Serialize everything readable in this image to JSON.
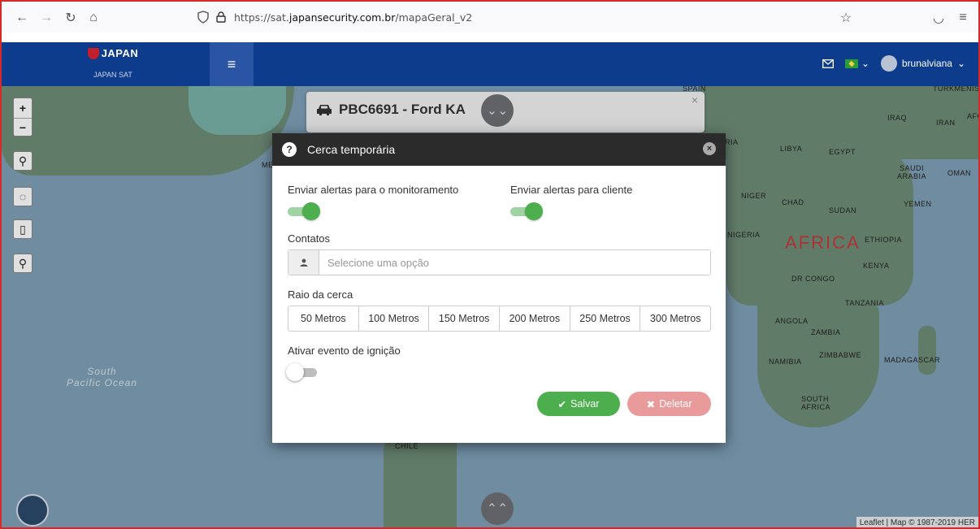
{
  "browser": {
    "url_prefix": "https://sat.",
    "url_domain": "japansecurity.com.br",
    "url_path": "/mapaGeral_v2"
  },
  "header": {
    "logo_text": "JAPAN",
    "logo_sub": "JAPAN SAT",
    "username": "brunalviana"
  },
  "map": {
    "vehicle_title": "PBC6691 - Ford KA",
    "labels": {
      "iraq": "IRAQ",
      "iran": "IRAN",
      "afg": "AFG",
      "libya": "LIBYA",
      "egypt": "EGYPT",
      "saudi": "SAUDI\nARABIA",
      "oman": "OMAN",
      "niger": "NIGER",
      "chad": "CHAD",
      "sudan": "SUDAN",
      "yemen": "YEMEN",
      "nigeria": "NIGERIA",
      "ethiopia": "ETHIOPIA",
      "kenya": "KENYA",
      "drcongo": "DR CONGO",
      "tanzania": "TANZANIA",
      "angola": "ANGOLA",
      "zambia": "ZAMBIA",
      "zimbabwe": "ZIMBABWE",
      "namibia": "NAMIBIA",
      "madagascar": "MADAGASCAR",
      "southafrica": "SOUTH\nAFRICA",
      "chile": "CHILE",
      "ria": "RIA",
      "me": "ME",
      "spain": "SPAIN",
      "turkmenistan": "TURKMENIST..."
    },
    "africa": "AFRICA",
    "ocean": "South\nPacific Ocean",
    "attribution": "Leaflet | Map © 1987-2019 HER"
  },
  "modal": {
    "title": "Cerca temporária",
    "alert_monitoring_label": "Enviar alertas para o monitoramento",
    "alert_monitoring_on": true,
    "alert_client_label": "Enviar alertas para cliente",
    "alert_client_on": true,
    "contacts_label": "Contatos",
    "contacts_placeholder": "Selecione uma opção",
    "radius_label": "Raio da cerca",
    "radius_options": [
      "50 Metros",
      "100 Metros",
      "150 Metros",
      "200 Metros",
      "250 Metros",
      "300 Metros"
    ],
    "ignition_label": "Ativar evento de ignição",
    "ignition_on": false,
    "save_label": "Salvar",
    "delete_label": "Deletar"
  },
  "colors": {
    "header_bg": "#0d3c8c",
    "success": "#4cae4c",
    "danger_light": "#e99a9a"
  }
}
